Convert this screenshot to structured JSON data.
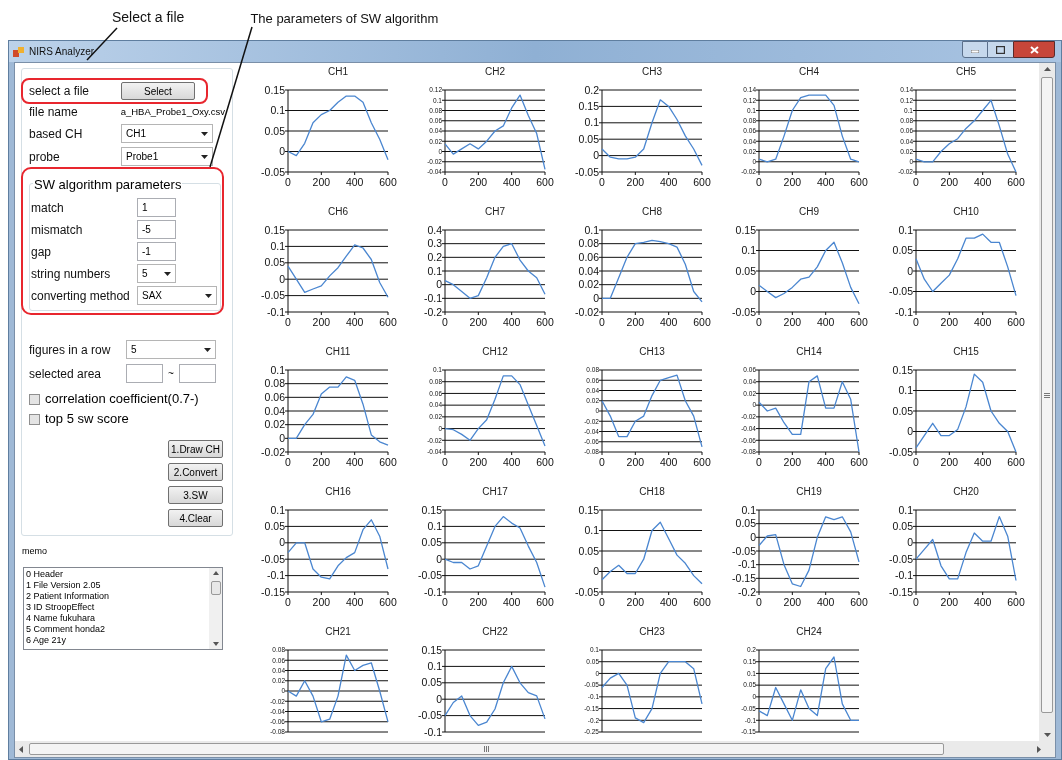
{
  "annotations": [
    {
      "text": "Select a file"
    },
    {
      "text": "The parameters of SW algorithm"
    }
  ],
  "window": {
    "title": "NIRS Analyzer"
  },
  "file_select": {
    "label": "select a file",
    "button": "Select"
  },
  "file_name": {
    "label": "file name",
    "value": "a_HBA_Probe1_Oxy.csv"
  },
  "based_ch": {
    "label": "based CH",
    "value": "CH1"
  },
  "probe": {
    "label": "probe",
    "value": "Probe1"
  },
  "sw_group": {
    "title": "SW algorithm parameters",
    "fields": [
      {
        "label": "match",
        "kind": "text",
        "value": "1"
      },
      {
        "label": "mismatch",
        "kind": "text",
        "value": "-5"
      },
      {
        "label": "gap",
        "kind": "text",
        "value": "-1"
      },
      {
        "label": "string numbers",
        "kind": "dropdown",
        "value": "5"
      },
      {
        "label": "converting method",
        "kind": "dropdown",
        "value": "SAX"
      }
    ]
  },
  "figures_in_row": {
    "label": "figures in a row",
    "value": "5"
  },
  "selected_area": {
    "label": "selected area",
    "separator": "~"
  },
  "checkboxes": [
    {
      "label": "correlation coefficient(0.7-)",
      "checked": false
    },
    {
      "label": "top 5 sw score",
      "checked": false
    }
  ],
  "action_buttons": [
    "1.Draw CH",
    "2.Convert",
    "3.SW",
    "4.Clear"
  ],
  "memo": {
    "label": "memo",
    "lines": [
      "0 Header",
      "1 File Version 2.05",
      "2 Patient Information",
      "3 ID StroopEffect",
      "4 Name fukuhara",
      "5 Comment honda2",
      "6 Age 21y"
    ]
  },
  "charts": [
    {
      "chart_data": {
        "type": "line",
        "title": "CH1",
        "grid": true,
        "x": [
          0,
          50,
          100,
          150,
          200,
          250,
          300,
          350,
          400,
          450,
          500,
          550,
          600
        ],
        "values": [
          0,
          -0.01,
          0.02,
          0.07,
          0.09,
          0.1,
          0.12,
          0.135,
          0.135,
          0.12,
          0.07,
          0.03,
          -0.02
        ],
        "xlim": [
          0,
          600
        ],
        "ylim": [
          -0.05,
          0.15
        ],
        "xticks": [
          0,
          200,
          400,
          600
        ],
        "yticks": [
          -0.05,
          0,
          0.05,
          0.1,
          0.15
        ]
      }
    },
    {
      "chart_data": {
        "type": "line",
        "title": "CH2",
        "grid": true,
        "x": [
          0,
          50,
          100,
          150,
          200,
          250,
          300,
          350,
          400,
          450,
          500,
          550,
          600
        ],
        "values": [
          0.015,
          -0.005,
          0.005,
          0.015,
          0.005,
          0.02,
          0.04,
          0.05,
          0.085,
          0.11,
          0.07,
          0.035,
          -0.035
        ],
        "xlim": [
          0,
          600
        ],
        "ylim": [
          -0.04,
          0.12
        ],
        "xticks": [
          0,
          200,
          400,
          600
        ],
        "yticks": [
          -0.04,
          -0.02,
          0,
          0.02,
          0.04,
          0.06,
          0.08,
          0.1,
          0.12
        ]
      }
    },
    {
      "chart_data": {
        "type": "line",
        "title": "CH3",
        "grid": true,
        "x": [
          0,
          50,
          100,
          150,
          200,
          250,
          300,
          350,
          400,
          450,
          500,
          550,
          600
        ],
        "values": [
          0.02,
          -0.005,
          -0.01,
          -0.01,
          -0.005,
          0.02,
          0.1,
          0.17,
          0.15,
          0.11,
          0.06,
          0.02,
          -0.03
        ],
        "xlim": [
          0,
          600
        ],
        "ylim": [
          -0.05,
          0.2
        ],
        "xticks": [
          0,
          200,
          400,
          600
        ],
        "yticks": [
          -0.05,
          0,
          0.05,
          0.1,
          0.15,
          0.2
        ]
      }
    },
    {
      "chart_data": {
        "type": "line",
        "title": "CH4",
        "grid": true,
        "x": [
          0,
          50,
          100,
          150,
          200,
          250,
          300,
          350,
          400,
          450,
          500,
          550,
          600
        ],
        "values": [
          0.005,
          0,
          0.005,
          0.05,
          0.1,
          0.125,
          0.13,
          0.13,
          0.13,
          0.11,
          0.05,
          0.005,
          0
        ],
        "xlim": [
          0,
          600
        ],
        "ylim": [
          -0.02,
          0.14
        ],
        "xticks": [
          0,
          200,
          400,
          600
        ],
        "yticks": [
          -0.02,
          0,
          0.02,
          0.04,
          0.06,
          0.08,
          0.1,
          0.12,
          0.14
        ]
      }
    },
    {
      "chart_data": {
        "type": "line",
        "title": "CH5",
        "grid": true,
        "x": [
          0,
          50,
          100,
          150,
          200,
          250,
          300,
          350,
          400,
          450,
          500,
          550,
          600
        ],
        "values": [
          0.005,
          0,
          0,
          0.02,
          0.035,
          0.045,
          0.065,
          0.08,
          0.1,
          0.12,
          0.07,
          0.015,
          -0.02
        ],
        "xlim": [
          0,
          600
        ],
        "ylim": [
          -0.02,
          0.14
        ],
        "xticks": [
          0,
          200,
          400,
          600
        ],
        "yticks": [
          -0.02,
          0,
          0.02,
          0.04,
          0.06,
          0.08,
          0.1,
          0.12,
          0.14
        ]
      }
    },
    {
      "chart_data": {
        "type": "line",
        "title": "CH6",
        "grid": true,
        "x": [
          0,
          50,
          100,
          150,
          200,
          250,
          300,
          350,
          400,
          450,
          500,
          550,
          600
        ],
        "values": [
          0.04,
          0,
          -0.04,
          -0.03,
          -0.02,
          0.01,
          0.035,
          0.07,
          0.105,
          0.095,
          0.06,
          -0.01,
          -0.055
        ],
        "xlim": [
          0,
          600
        ],
        "ylim": [
          -0.1,
          0.15
        ],
        "xticks": [
          0,
          200,
          400,
          600
        ],
        "yticks": [
          -0.1,
          -0.05,
          0,
          0.05,
          0.1,
          0.15
        ]
      }
    },
    {
      "chart_data": {
        "type": "line",
        "title": "CH7",
        "grid": true,
        "x": [
          0,
          50,
          100,
          150,
          200,
          250,
          300,
          350,
          400,
          450,
          500,
          550,
          600
        ],
        "values": [
          0.03,
          0,
          -0.05,
          -0.1,
          -0.08,
          0.05,
          0.2,
          0.28,
          0.3,
          0.18,
          0.1,
          0.05,
          -0.07
        ],
        "xlim": [
          0,
          600
        ],
        "ylim": [
          -0.2,
          0.4
        ],
        "xticks": [
          0,
          200,
          400,
          600
        ],
        "yticks": [
          -0.2,
          -0.1,
          0,
          0.1,
          0.2,
          0.3,
          0.4
        ]
      }
    },
    {
      "chart_data": {
        "type": "line",
        "title": "CH8",
        "grid": true,
        "x": [
          0,
          50,
          100,
          150,
          200,
          250,
          300,
          350,
          400,
          450,
          500,
          550,
          600
        ],
        "values": [
          0,
          0,
          0.03,
          0.06,
          0.08,
          0.082,
          0.085,
          0.083,
          0.08,
          0.075,
          0.05,
          0.01,
          -0.005
        ],
        "xlim": [
          0,
          600
        ],
        "ylim": [
          -0.02,
          0.1
        ],
        "xticks": [
          0,
          200,
          400,
          600
        ],
        "yticks": [
          -0.02,
          0,
          0.02,
          0.04,
          0.06,
          0.08,
          0.1
        ]
      }
    },
    {
      "chart_data": {
        "type": "line",
        "title": "CH9",
        "grid": true,
        "x": [
          0,
          50,
          100,
          150,
          200,
          250,
          300,
          350,
          400,
          450,
          500,
          550,
          600
        ],
        "values": [
          0.015,
          0,
          -0.015,
          -0.005,
          0.01,
          0.03,
          0.035,
          0.06,
          0.1,
          0.12,
          0.07,
          0.01,
          -0.03
        ],
        "xlim": [
          0,
          600
        ],
        "ylim": [
          -0.05,
          0.15
        ],
        "xticks": [
          0,
          200,
          400,
          600
        ],
        "yticks": [
          -0.05,
          0,
          0.05,
          0.1,
          0.15
        ]
      }
    },
    {
      "chart_data": {
        "type": "line",
        "title": "CH10",
        "grid": true,
        "x": [
          0,
          50,
          100,
          150,
          200,
          250,
          300,
          350,
          400,
          450,
          500,
          550,
          600
        ],
        "values": [
          0.03,
          -0.02,
          -0.05,
          -0.03,
          -0.01,
          0.03,
          0.08,
          0.08,
          0.09,
          0.07,
          0.07,
          0.01,
          -0.06
        ],
        "xlim": [
          0,
          600
        ],
        "ylim": [
          -0.1,
          0.1
        ],
        "xticks": [
          0,
          200,
          400,
          600
        ],
        "yticks": [
          -0.1,
          -0.05,
          0,
          0.05,
          0.1
        ]
      }
    },
    {
      "chart_data": {
        "type": "line",
        "title": "CH11",
        "grid": true,
        "x": [
          0,
          50,
          100,
          150,
          200,
          250,
          300,
          350,
          400,
          450,
          500,
          550,
          600
        ],
        "values": [
          0,
          0,
          0.02,
          0.035,
          0.065,
          0.075,
          0.075,
          0.09,
          0.085,
          0.05,
          0.005,
          -0.005,
          -0.01
        ],
        "xlim": [
          0,
          600
        ],
        "ylim": [
          -0.02,
          0.1
        ],
        "xticks": [
          0,
          200,
          400,
          600
        ],
        "yticks": [
          -0.02,
          0,
          0.02,
          0.04,
          0.06,
          0.08,
          0.1
        ]
      }
    },
    {
      "chart_data": {
        "type": "line",
        "title": "CH12",
        "grid": true,
        "x": [
          0,
          50,
          100,
          150,
          200,
          250,
          300,
          350,
          400,
          450,
          500,
          550,
          600
        ],
        "values": [
          0,
          -0.002,
          -0.01,
          -0.02,
          0,
          0.015,
          0.05,
          0.09,
          0.09,
          0.075,
          0.04,
          0.005,
          -0.03
        ],
        "xlim": [
          0,
          600
        ],
        "ylim": [
          -0.04,
          0.1
        ],
        "xticks": [
          0,
          200,
          400,
          600
        ],
        "yticks": [
          -0.04,
          -0.02,
          0,
          0.02,
          0.04,
          0.06,
          0.08,
          0.1
        ]
      }
    },
    {
      "chart_data": {
        "type": "line",
        "title": "CH13",
        "grid": true,
        "x": [
          0,
          50,
          100,
          150,
          200,
          250,
          300,
          350,
          400,
          450,
          500,
          550,
          600
        ],
        "values": [
          0.02,
          -0.01,
          -0.05,
          -0.05,
          -0.02,
          -0.01,
          0.03,
          0.06,
          0.065,
          0.07,
          0.02,
          -0.01,
          -0.07
        ],
        "xlim": [
          0,
          600
        ],
        "ylim": [
          -0.08,
          0.08
        ],
        "xticks": [
          0,
          200,
          400,
          600
        ],
        "yticks": [
          -0.08,
          -0.06,
          -0.04,
          -0.02,
          0,
          0.02,
          0.04,
          0.06,
          0.08
        ]
      }
    },
    {
      "chart_data": {
        "type": "line",
        "title": "CH14",
        "grid": true,
        "x": [
          0,
          50,
          100,
          150,
          200,
          250,
          300,
          350,
          400,
          450,
          500,
          550,
          600
        ],
        "values": [
          0.005,
          -0.01,
          -0.005,
          -0.03,
          -0.05,
          -0.05,
          0.04,
          0.05,
          -0.005,
          -0.005,
          0.04,
          0.01,
          -0.08
        ],
        "xlim": [
          0,
          600
        ],
        "ylim": [
          -0.08,
          0.06
        ],
        "xticks": [
          0,
          200,
          400,
          600
        ],
        "yticks": [
          -0.08,
          -0.06,
          -0.04,
          -0.02,
          0,
          0.02,
          0.04,
          0.06
        ]
      }
    },
    {
      "chart_data": {
        "type": "line",
        "title": "CH15",
        "grid": true,
        "x": [
          0,
          50,
          100,
          150,
          200,
          250,
          300,
          350,
          400,
          450,
          500,
          550,
          600
        ],
        "values": [
          -0.04,
          -0.01,
          0.02,
          -0.01,
          -0.01,
          0.005,
          0.06,
          0.14,
          0.12,
          0.05,
          0.02,
          0,
          -0.05
        ],
        "xlim": [
          0,
          600
        ],
        "ylim": [
          -0.05,
          0.15
        ],
        "xticks": [
          0,
          200,
          400,
          600
        ],
        "yticks": [
          -0.05,
          0,
          0.05,
          0.1,
          0.15
        ]
      }
    },
    {
      "chart_data": {
        "type": "line",
        "title": "CH16",
        "grid": true,
        "x": [
          0,
          50,
          100,
          150,
          200,
          250,
          300,
          350,
          400,
          450,
          500,
          550,
          600
        ],
        "values": [
          -0.03,
          0,
          0,
          -0.08,
          -0.105,
          -0.11,
          -0.07,
          -0.045,
          -0.03,
          0.04,
          0.07,
          0.02,
          -0.08
        ],
        "xlim": [
          0,
          600
        ],
        "ylim": [
          -0.15,
          0.1
        ],
        "xticks": [
          0,
          200,
          400,
          600
        ],
        "yticks": [
          -0.15,
          -0.1,
          -0.05,
          0,
          0.05,
          0.1
        ]
      }
    },
    {
      "chart_data": {
        "type": "line",
        "title": "CH17",
        "grid": true,
        "x": [
          0,
          50,
          100,
          150,
          200,
          250,
          300,
          350,
          400,
          450,
          500,
          550,
          600
        ],
        "values": [
          0,
          -0.01,
          -0.01,
          -0.03,
          -0.02,
          0.04,
          0.1,
          0.13,
          0.11,
          0.095,
          0.04,
          -0.01,
          -0.085
        ],
        "xlim": [
          0,
          600
        ],
        "ylim": [
          -0.1,
          0.15
        ],
        "xticks": [
          0,
          200,
          400,
          600
        ],
        "yticks": [
          -0.1,
          -0.05,
          0,
          0.05,
          0.1,
          0.15
        ]
      }
    },
    {
      "chart_data": {
        "type": "line",
        "title": "CH18",
        "grid": true,
        "x": [
          0,
          50,
          100,
          150,
          200,
          250,
          300,
          350,
          400,
          450,
          500,
          550,
          600
        ],
        "values": [
          -0.02,
          0,
          0.015,
          -0.005,
          -0.005,
          0.03,
          0.1,
          0.12,
          0.08,
          0.04,
          0.02,
          -0.01,
          -0.03
        ],
        "xlim": [
          0,
          600
        ],
        "ylim": [
          -0.05,
          0.15
        ],
        "xticks": [
          0,
          200,
          400,
          600
        ],
        "yticks": [
          -0.05,
          0,
          0.05,
          0.1,
          0.15
        ]
      }
    },
    {
      "chart_data": {
        "type": "line",
        "title": "CH19",
        "grid": true,
        "x": [
          0,
          50,
          100,
          150,
          200,
          250,
          300,
          350,
          400,
          450,
          500,
          550,
          600
        ],
        "values": [
          -0.03,
          0.005,
          0.01,
          -0.1,
          -0.17,
          -0.18,
          -0.12,
          0,
          0.075,
          0.065,
          0.075,
          0.02,
          -0.09
        ],
        "xlim": [
          0,
          600
        ],
        "ylim": [
          -0.2,
          0.1
        ],
        "xticks": [
          0,
          200,
          400,
          600
        ],
        "yticks": [
          -0.2,
          -0.15,
          -0.1,
          -0.05,
          0,
          0.05,
          0.1
        ]
      }
    },
    {
      "chart_data": {
        "type": "line",
        "title": "CH20",
        "grid": true,
        "x": [
          0,
          50,
          100,
          150,
          200,
          250,
          300,
          350,
          400,
          450,
          500,
          550,
          600
        ],
        "values": [
          -0.05,
          -0.02,
          0.01,
          -0.07,
          -0.11,
          -0.11,
          -0.03,
          0.03,
          0.005,
          0.005,
          0.08,
          0.02,
          -0.115
        ],
        "xlim": [
          0,
          600
        ],
        "ylim": [
          -0.15,
          0.1
        ],
        "xticks": [
          0,
          200,
          400,
          600
        ],
        "yticks": [
          -0.15,
          -0.1,
          -0.05,
          0,
          0.05,
          0.1
        ]
      }
    },
    {
      "chart_data": {
        "type": "line",
        "title": "CH21",
        "grid": true,
        "x": [
          0,
          50,
          100,
          150,
          200,
          250,
          300,
          350,
          400,
          450,
          500,
          550,
          600
        ],
        "values": [
          0,
          -0.01,
          0.02,
          -0.01,
          -0.06,
          -0.055,
          -0.01,
          0.07,
          0.04,
          0.05,
          0.055,
          0,
          -0.06
        ],
        "xlim": [
          0,
          600
        ],
        "ylim": [
          -0.08,
          0.08
        ],
        "yticks": [
          -0.08,
          -0.06,
          -0.04,
          -0.02,
          0,
          0.02,
          0.04,
          0.06,
          0.08
        ]
      }
    },
    {
      "chart_data": {
        "type": "line",
        "title": "CH22",
        "grid": true,
        "x": [
          0,
          50,
          100,
          150,
          200,
          250,
          300,
          350,
          400,
          450,
          500,
          550,
          600
        ],
        "values": [
          -0.05,
          -0.01,
          0.01,
          -0.05,
          -0.08,
          -0.07,
          -0.03,
          0.05,
          0.1,
          0.05,
          0.02,
          0.01,
          -0.06
        ],
        "xlim": [
          0,
          600
        ],
        "ylim": [
          -0.1,
          0.15
        ],
        "yticks": [
          -0.1,
          -0.05,
          0,
          0.05,
          0.1,
          0.15
        ]
      }
    },
    {
      "chart_data": {
        "type": "line",
        "title": "CH23",
        "grid": true,
        "x": [
          0,
          50,
          100,
          150,
          200,
          250,
          300,
          350,
          400,
          450,
          500,
          550,
          600
        ],
        "values": [
          -0.06,
          -0.02,
          0,
          -0.05,
          -0.19,
          -0.21,
          -0.15,
          0,
          0.05,
          0.05,
          0.05,
          0.02,
          -0.13
        ],
        "xlim": [
          0,
          600
        ],
        "ylim": [
          -0.25,
          0.1
        ],
        "yticks": [
          -0.25,
          -0.2,
          -0.15,
          -0.1,
          -0.05,
          0,
          0.05,
          0.1
        ]
      }
    },
    {
      "chart_data": {
        "type": "line",
        "title": "CH24",
        "grid": true,
        "x": [
          0,
          50,
          100,
          150,
          200,
          250,
          300,
          350,
          400,
          450,
          500,
          550,
          600
        ],
        "values": [
          -0.06,
          -0.08,
          0.04,
          -0.03,
          -0.1,
          0.03,
          -0.05,
          -0.08,
          0.12,
          0.17,
          -0.03,
          -0.1,
          -0.1
        ],
        "xlim": [
          0,
          600
        ],
        "ylim": [
          -0.15,
          0.2
        ],
        "yticks": [
          -0.15,
          -0.1,
          -0.05,
          0,
          0.05,
          0.1,
          0.15,
          0.2
        ]
      }
    }
  ]
}
